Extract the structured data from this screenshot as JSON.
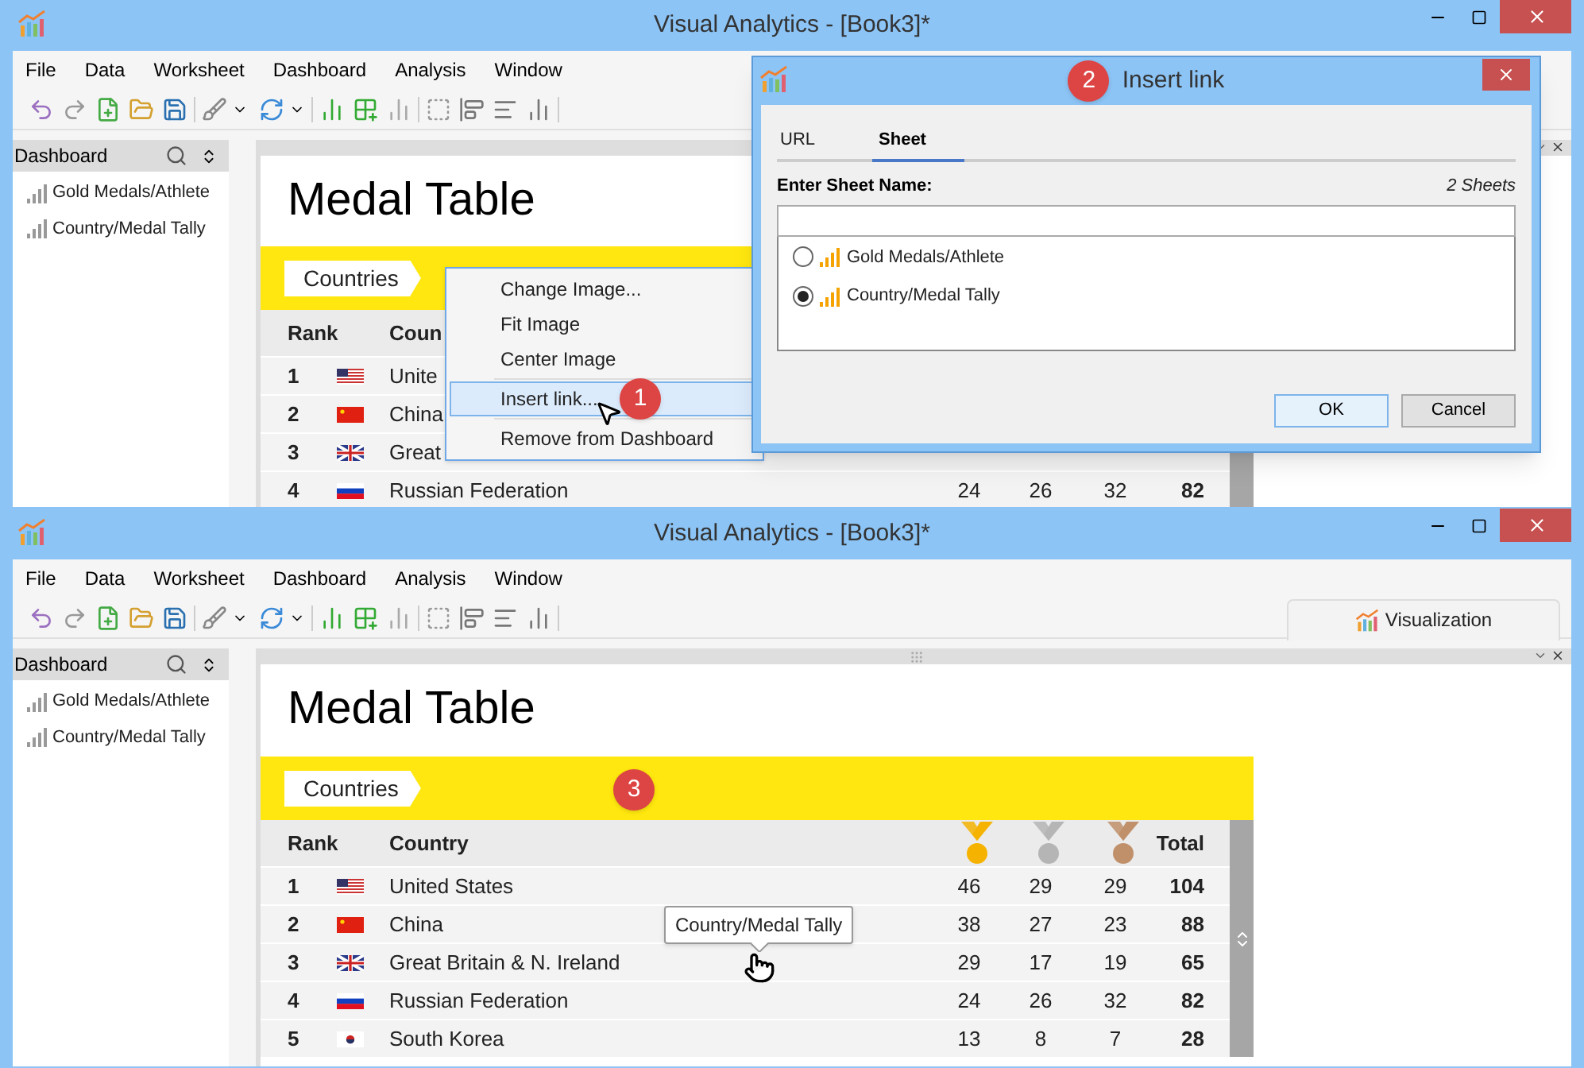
{
  "windows": [
    {
      "title": "Visual Analytics - [Book3]*",
      "menu": [
        "File",
        "Data",
        "Worksheet",
        "Dashboard",
        "Analysis",
        "Window"
      ],
      "sidebar": {
        "title": "Dashboard",
        "items": [
          "Gold Medals/Athlete",
          "Country/Medal Tally"
        ]
      },
      "dashboard": {
        "title": "Medal Table",
        "tag": "Countries",
        "table": {
          "header": {
            "rank": "Rank",
            "country": "Coun"
          },
          "rows": [
            {
              "rank": "1",
              "kind": "us",
              "country": "Unite"
            },
            {
              "rank": "2",
              "kind": "cn",
              "country": "China"
            },
            {
              "rank": "3",
              "kind": "gb",
              "country": "Great"
            },
            {
              "rank": "4",
              "kind": "ru",
              "country": "Russian Federation",
              "gold": "24",
              "silver": "26",
              "bronze": "32",
              "total": "82"
            }
          ]
        }
      },
      "context_menu": {
        "items": [
          {
            "kind": "item",
            "label": "Change Image...",
            "selected": false
          },
          {
            "kind": "item",
            "label": "Fit Image",
            "selected": false
          },
          {
            "kind": "item",
            "label": "Center Image",
            "selected": false
          },
          {
            "kind": "separator"
          },
          {
            "kind": "item",
            "label": "Insert link...",
            "selected": true
          },
          {
            "kind": "separator"
          },
          {
            "kind": "item",
            "label": "Remove from Dashboard",
            "selected": false
          }
        ],
        "badge": "1"
      },
      "dialog": {
        "title": "Insert link",
        "badge": "2",
        "tabs": [
          {
            "label": "URL",
            "selected": false
          },
          {
            "label": "Sheet",
            "selected": true
          }
        ],
        "field_label": "Enter Sheet Name:",
        "count": "2 Sheets",
        "options": [
          {
            "label": "Gold Medals/Athlete",
            "selected": false
          },
          {
            "label": "Country/Medal Tally",
            "selected": true
          }
        ],
        "buttons": [
          "OK",
          "Cancel"
        ]
      }
    },
    {
      "title": "Visual Analytics - [Book3]*",
      "menu": [
        "File",
        "Data",
        "Worksheet",
        "Dashboard",
        "Analysis",
        "Window"
      ],
      "view_tab": "Visualization",
      "sidebar": {
        "title": "Dashboard",
        "items": [
          "Gold Medals/Athlete",
          "Country/Medal Tally"
        ]
      },
      "dashboard": {
        "title": "Medal Table",
        "tag": "Countries",
        "badge": "3",
        "table": {
          "header": {
            "rank": "Rank",
            "country": "Country",
            "total": "Total"
          },
          "show_medals": true,
          "rows": [
            {
              "rank": "1",
              "kind": "us",
              "country": "United States",
              "gold": "46",
              "silver": "29",
              "bronze": "29",
              "total": "104"
            },
            {
              "rank": "2",
              "kind": "cn",
              "country": "China",
              "gold": "38",
              "silver": "27",
              "bronze": "23",
              "total": "88"
            },
            {
              "rank": "3",
              "kind": "gb",
              "country": "Great Britain & N. Ireland",
              "gold": "29",
              "silver": "17",
              "bronze": "19",
              "total": "65"
            },
            {
              "rank": "4",
              "kind": "ru",
              "country": "Russian Federation",
              "gold": "24",
              "silver": "26",
              "bronze": "32",
              "total": "82"
            },
            {
              "rank": "5",
              "kind": "kr",
              "country": "South Korea",
              "gold": "13",
              "silver": "8",
              "bronze": "7",
              "total": "28"
            }
          ]
        }
      },
      "tooltip": "Country/Medal Tally"
    }
  ]
}
